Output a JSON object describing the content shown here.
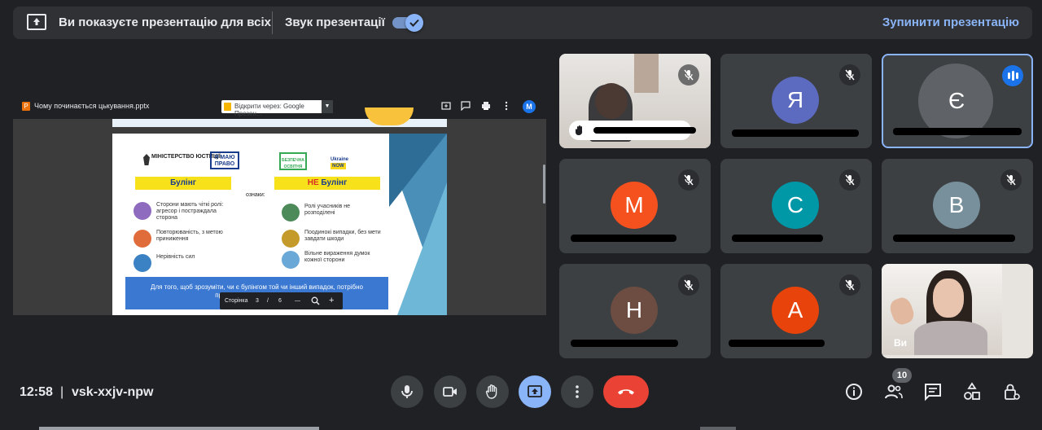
{
  "banner": {
    "message": "Ви показуєте презентацію для всіх",
    "audio_label": "Звук презентації",
    "audio_on": true,
    "stop_label": "Зупинити презентацію",
    "accent": "#8ab4f8"
  },
  "presentation": {
    "file_name": "Чому починається цькування.pptx",
    "open_with": "Відкрити через: Google Презен...",
    "user_initial": "M",
    "slide": {
      "header_left": "Булінг",
      "header_right_prefix": "НЕ",
      "header_right_word": " Булінг",
      "signs_label": "ознаки:",
      "logo_ministry": "МІНІСТЕРСТВО ЮСТИЦІЇ",
      "logo_right": "Я МАЮ ПРАВО",
      "logo_safe": "БЕЗПЕЧНА ОСВІТНЯ",
      "logo_ukraine": "Ukraine",
      "logo_now": "NOW",
      "items_left": [
        "Сторони мають чіткі ролі: агресор і постраждала сторона",
        "Повторюваність, з метою приниження",
        "Нерівність сил"
      ],
      "items_right": [
        "Ролі учасників не розподілені",
        "Поодинокі випадки, без мети завдати шкоди",
        "Вільне вираження думок кожної сторони"
      ],
      "bottom_text": "Для того, щоб зрозуміти, чи є булінгом той чи інший випадок, потрібно проаналізувати ... наслідки."
    },
    "pager": {
      "label": "Сторінка",
      "current": "3",
      "slash": "/",
      "total": "6",
      "minus": "—",
      "plus": "+"
    }
  },
  "participants": [
    {
      "id": "video1",
      "type": "video",
      "hand_raised": true
    },
    {
      "id": "ya",
      "initial": "Я",
      "color": "#5c6bc0",
      "muted": true
    },
    {
      "id": "ye",
      "initial": "Є",
      "color": "#5f6368",
      "speaking": true
    },
    {
      "id": "m",
      "initial": "М",
      "color": "#f4511e",
      "muted": true
    },
    {
      "id": "s",
      "initial": "С",
      "color": "#0097a7",
      "muted": true
    },
    {
      "id": "v",
      "initial": "В",
      "color": "#78909c",
      "muted": true
    },
    {
      "id": "n",
      "initial": "Н",
      "color": "#6d4c41",
      "muted": true
    },
    {
      "id": "a",
      "initial": "А",
      "color": "#e8430b",
      "muted": true
    },
    {
      "id": "self",
      "type": "video",
      "name": "Ви"
    }
  ],
  "footer": {
    "time": "12:58",
    "separator": "|",
    "meeting_code": "vsk-xxjv-npw",
    "people_count": "10"
  }
}
